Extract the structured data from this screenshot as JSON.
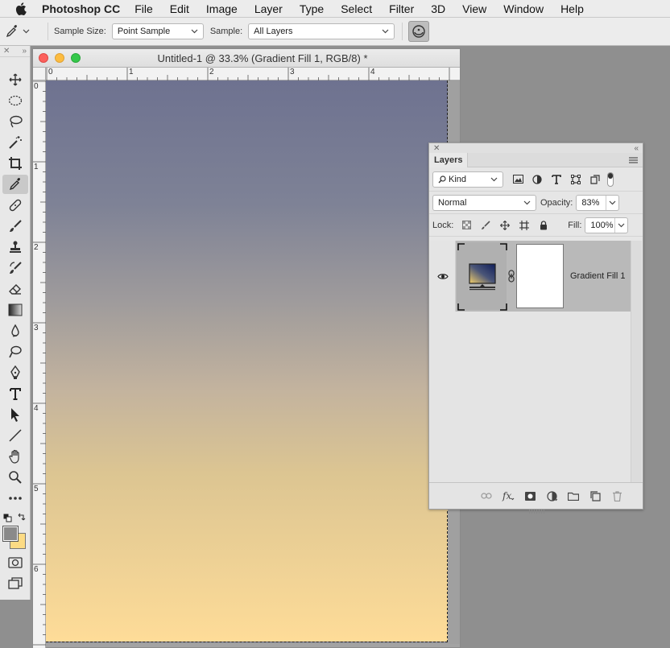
{
  "menubar": {
    "app_name": "Photoshop CC",
    "items": [
      "File",
      "Edit",
      "Image",
      "Layer",
      "Type",
      "Select",
      "Filter",
      "3D",
      "View",
      "Window",
      "Help"
    ]
  },
  "options": {
    "sample_size_label": "Sample Size:",
    "sample_size_value": "Point Sample",
    "sample_label": "Sample:",
    "sample_value": "All Layers"
  },
  "tools": [
    {
      "name": "move-tool-icon"
    },
    {
      "name": "marquee-tool-icon"
    },
    {
      "name": "lasso-tool-icon"
    },
    {
      "name": "magic-wand-tool-icon"
    },
    {
      "name": "crop-tool-icon"
    },
    {
      "name": "eyedropper-tool-icon",
      "active": true
    },
    {
      "name": "healing-brush-tool-icon"
    },
    {
      "name": "brush-tool-icon"
    },
    {
      "name": "clone-stamp-tool-icon"
    },
    {
      "name": "history-brush-tool-icon"
    },
    {
      "name": "eraser-tool-icon"
    },
    {
      "name": "gradient-tool-icon"
    },
    {
      "name": "blur-tool-icon"
    },
    {
      "name": "dodge-tool-icon"
    },
    {
      "name": "pen-tool-icon"
    },
    {
      "name": "type-tool-icon"
    },
    {
      "name": "path-selection-tool-icon"
    },
    {
      "name": "line-tool-icon"
    },
    {
      "name": "hand-tool-icon"
    },
    {
      "name": "zoom-tool-icon"
    },
    {
      "name": "more-tools-icon"
    }
  ],
  "colors": {
    "foreground": "#8a8a8a",
    "background": "#fcdb84",
    "gradient_top": "#6e7290",
    "gradient_bottom": "#fedc98"
  },
  "document": {
    "title": "Untitled-1 @ 33.3% (Gradient Fill 1, RGB/8) *",
    "ruler_h": [
      "0",
      "1",
      "2",
      "3",
      "4"
    ],
    "ruler_v": [
      "0",
      "1",
      "2",
      "3",
      "4",
      "5",
      "6"
    ]
  },
  "layers_panel": {
    "tab": "Layers",
    "filter_kind": "Kind",
    "blend_mode": "Normal",
    "opacity_label": "Opacity:",
    "opacity_value": "83%",
    "lock_label": "Lock:",
    "fill_label": "Fill:",
    "fill_value": "100%",
    "layers": [
      {
        "name": "Gradient Fill 1",
        "visible": true
      }
    ]
  }
}
